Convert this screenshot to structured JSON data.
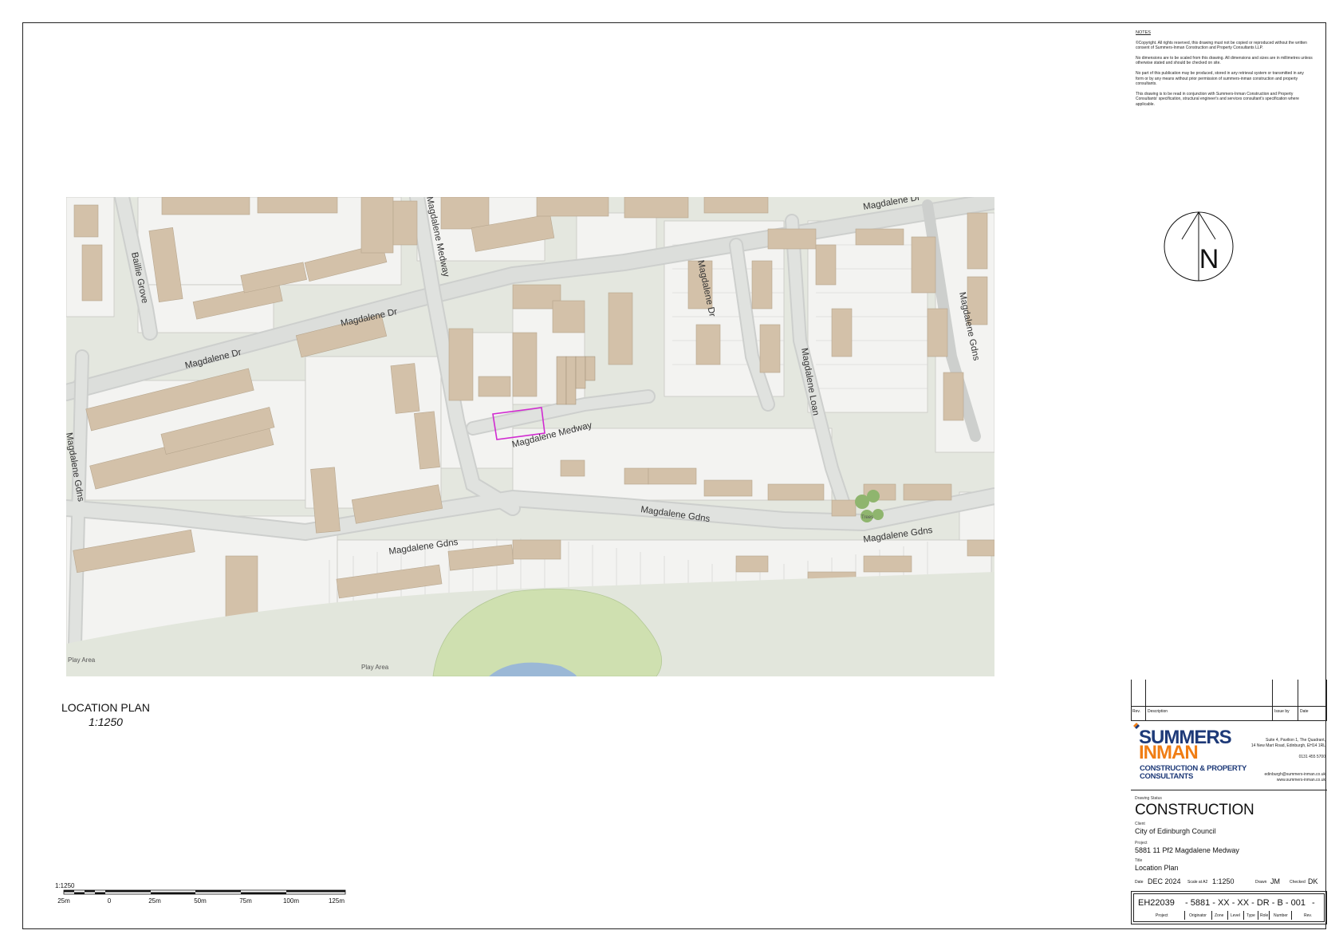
{
  "notes": {
    "heading": "NOTES",
    "items": [
      "©Copyright. All rights reserved, this drawing must not be copied or reproduced without the written consent of Summers-Inman Construction and Property Consultants LLP.",
      "No dimensions are to be scaled from this drawing. All dimensions and sizes are in millimetres unless otherwise stated and should be checked on site.",
      "No part of this publication may be produced, stored in any retrieval system or transmitted in any form or by any means without prior permission of summers-inman construction and property consultants.",
      "This drawing is to be read in conjunction with Summers-Inman Construction and Property Consultants' specification, structural engineer's and services consultant's specification where applicable."
    ]
  },
  "compass": {
    "letter": "N"
  },
  "map": {
    "streets": [
      "Magdalene Dr",
      "Magdalene Dr",
      "Magdalene Dr",
      "Magdalene Dr",
      "Baillie Grove",
      "Magdalene Medway",
      "Magdalene Medway",
      "Magdalene Gdns",
      "Magdalene Gdns",
      "Magdalene Gdns",
      "Magdalene Gdns",
      "Magdalene Gdns",
      "Magdalene Loan"
    ],
    "areas": [
      "Play Area",
      "Play Area",
      "Trees"
    ]
  },
  "location_plan": {
    "title": "LOCATION PLAN",
    "scale": "1:1250"
  },
  "scalebar": {
    "scale_label": "1:1250",
    "ticks": [
      "25m",
      "0",
      "25m",
      "50m",
      "75m",
      "100m",
      "125m"
    ]
  },
  "title_block": {
    "revision_headers": {
      "rev": "Rev.",
      "description": "Description",
      "issue_by": "Issue by",
      "date": "Date"
    },
    "company": {
      "name_line1": "SUMMERS",
      "name_line2": "INMAN",
      "tagline_line1": "CONSTRUCTION & PROPERTY",
      "tagline_line2": "CONSULTANTS",
      "address_line1": "Suite 4, Pavilion 1, The Quadrant,",
      "address_line2": "14 New Mart Road, Edinburgh, EH14 1RL",
      "phone": "0131 455 5700",
      "email": "edinburgh@summers-inman.co.uk",
      "web": "www.summers-inman.co.uk",
      "brand_blue": "#1e3a78",
      "brand_orange": "#f07d14"
    },
    "drawing_status_label": "Drawing Status",
    "drawing_status": "CONSTRUCTION",
    "client_label": "Client",
    "client": "City of Edinburgh Council",
    "project_label": "Project",
    "project": "5881 11 Pf2 Magdalene Medway",
    "title_label": "Title",
    "title": "Location Plan",
    "date_label": "Date",
    "date": "DEC 2024",
    "scale_label": "Scale at A2",
    "scale": "1:1250",
    "drawn_label": "Drawn",
    "drawn": "JM",
    "checked_label": "Checked",
    "checked": "DK",
    "code": {
      "project": "EH22039",
      "rest": "- 5881 - XX - XX - DR - B - 001",
      "rev": "-",
      "labels": [
        "Project",
        "Originator",
        "Zone",
        "Level",
        "Type",
        "Role",
        "Number",
        "Rev."
      ]
    }
  }
}
